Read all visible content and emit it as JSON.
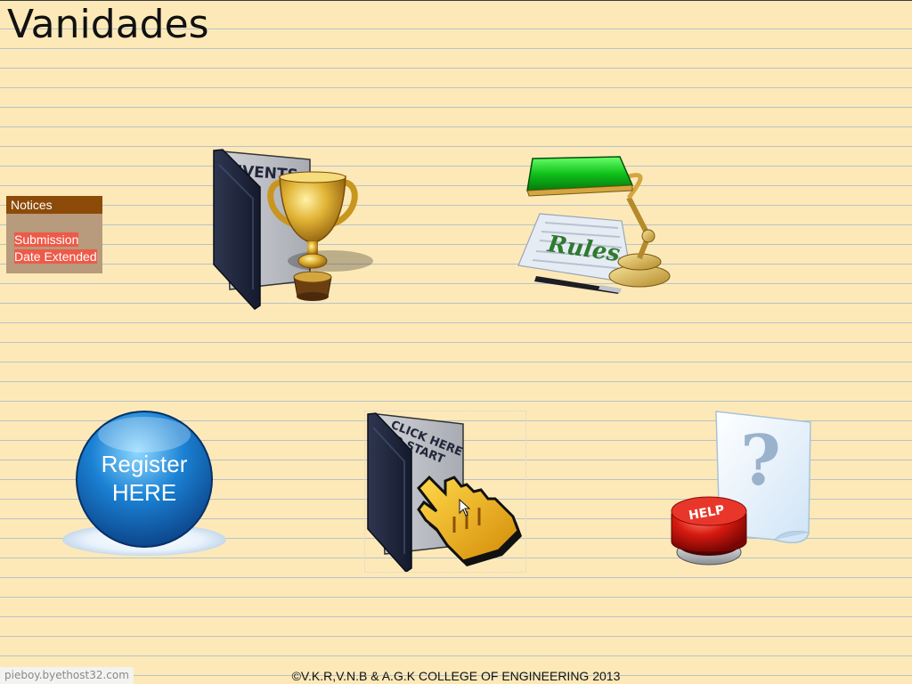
{
  "site": {
    "title": "Vanidades"
  },
  "notices": {
    "heading": "Notices",
    "items": [
      {
        "label": "Submission Date Extended"
      }
    ]
  },
  "tiles": {
    "events": {
      "label": "EVENTS"
    },
    "rules": {
      "label": "Rules"
    },
    "register": {
      "line1": "Register",
      "line2": "HERE"
    },
    "start": {
      "line1": "CLICK HERE",
      "line2": "TO START"
    },
    "help": {
      "label": "HELP",
      "symbol": "?"
    }
  },
  "footer": {
    "copyright": "©V.K.R,V.N.B & A.G.K COLLEGE OF ENGINEERING 2013"
  },
  "host_badge": "pieboy.byethost32.com",
  "colors": {
    "page_background": "#fde9b8",
    "ruled_line": "#b7c3c8",
    "notices_header": "#8c4b08",
    "notices_body": "#b89a7c",
    "notice_highlight": "#ee5a48"
  },
  "icons": [
    "trophy-icon",
    "desk-lamp-icon",
    "register-button-icon",
    "hand-cursor-icon",
    "help-button-icon",
    "question-document-icon"
  ]
}
